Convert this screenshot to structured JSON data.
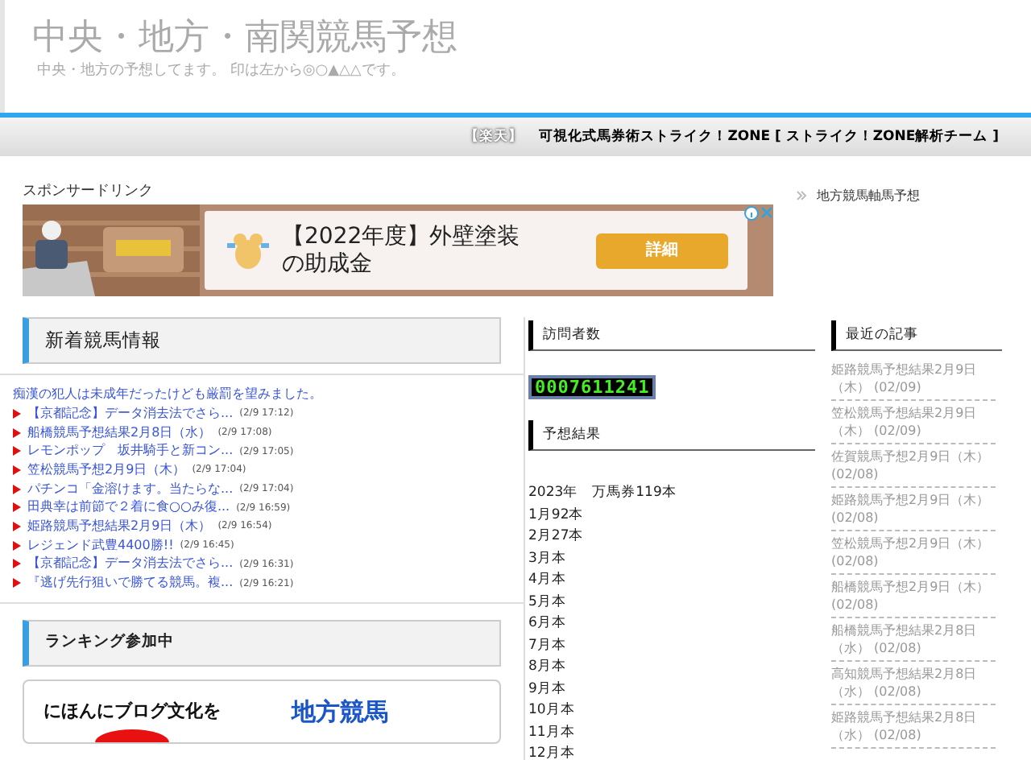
{
  "site": {
    "title": "中央・地方・南関競馬予想",
    "tagline": "中央・地方の予想してます。 印は左から◎○▲△△です。"
  },
  "ticker": {
    "source": "【楽天】",
    "text": "可視化式馬券術ストライク！ZONE [ ストライク！ZONE解析チーム ]"
  },
  "sponsor": {
    "label": "スポンサードリンク",
    "ad": {
      "kind": "picture",
      "headline": "【2022年度】外壁塗装の助成金",
      "button": "詳細"
    }
  },
  "side_link": "地方競馬軸馬予想",
  "news": {
    "heading": "新着競馬情報",
    "headline": "痴漢の犯人は未成年だったけども厳罰を望みました。",
    "items": [
      {
        "title": "【京都記念】データ消去法でさら...",
        "time": "(2/9 17:12)"
      },
      {
        "title": "船橋競馬予想結果2月8日（水）",
        "time": "(2/9 17:08)"
      },
      {
        "title": "レモンポップ　坂井騎手と新コン...",
        "time": "(2/9 17:05)"
      },
      {
        "title": "笠松競馬予想2月9日（木）",
        "time": "(2/9 17:04)"
      },
      {
        "title": "パチンコ「金溶けます。当たらな...",
        "time": "(2/9 17:04)"
      },
      {
        "title": "田典幸は前節で２着に食○○み復...",
        "time": "(2/9 16:59)"
      },
      {
        "title": "姫路競馬予想結果2月9日（木）",
        "time": "(2/9 16:54)"
      },
      {
        "title": "レジェンド武豊4400勝!!",
        "time": "(2/9 16:45)"
      },
      {
        "title": "【京都記念】データ消去法でさら...",
        "time": "(2/9 16:31)"
      },
      {
        "title": "『逃げ先行狙いで勝てる競馬。複...",
        "time": "(2/9 16:21)"
      }
    ]
  },
  "ranking": {
    "heading": "ランキング参加中",
    "banner_text": "にほんにブログ文化を",
    "banner_category": "地方競馬"
  },
  "visitors": {
    "heading": "訪問者数",
    "counter": "0007611241"
  },
  "results": {
    "heading": "予想結果",
    "lines": [
      "2023年　万馬券119本",
      "1月92本",
      "2月27本",
      "3月本",
      "4月本",
      "5月本",
      "6月本",
      "7月本",
      "8月本",
      "9月本",
      "10月本",
      "11月本",
      "12月本"
    ]
  },
  "recent": {
    "heading": "最近の記事",
    "items": [
      {
        "title": "姫路競馬予想結果2月9日（木）",
        "date": "(02/09)"
      },
      {
        "title": "笠松競馬予想結果2月9日（木）",
        "date": "(02/09)"
      },
      {
        "title": "佐賀競馬予想2月9日（木）",
        "date": "(02/08)"
      },
      {
        "title": "姫路競馬予想2月9日（木）",
        "date": "(02/08)"
      },
      {
        "title": "笠松競馬予想2月9日（木）",
        "date": "(02/08)"
      },
      {
        "title": "船橋競馬予想2月9日（木）",
        "date": "(02/08)"
      },
      {
        "title": "船橋競馬予想結果2月8日（水）",
        "date": "(02/08)"
      },
      {
        "title": "高知競馬予想結果2月8日（水）",
        "date": "(02/08)"
      },
      {
        "title": "姫路競馬予想結果2月8日（水）",
        "date": "(02/08)"
      }
    ]
  }
}
